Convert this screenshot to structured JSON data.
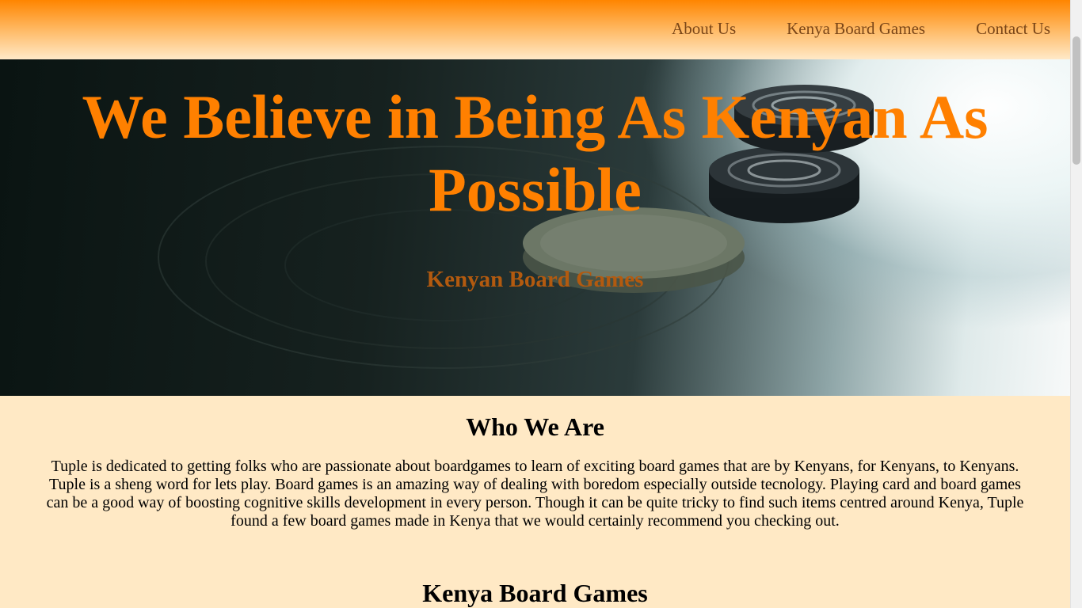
{
  "nav": {
    "links": [
      "About Us",
      "Kenya Board Games",
      "Contact Us"
    ]
  },
  "hero": {
    "title": "We Believe in Being As Kenyan As Possible",
    "subtitle": "Kenyan Board Games",
    "image_description": "board game pieces"
  },
  "about": {
    "heading": "Who We Are",
    "text": "Tuple is dedicated to getting folks who are passionate about boardgames to learn of exciting board games that are by Kenyans, for Kenyans, to Kenyans. Tuple is a sheng word for lets play. Board games is an amazing way of dealing with boredom especially outside tecnology. Playing card and board games can be a good way of boosting cognitive skills development in every person. Though it can be quite tricky to find such items centred around Kenya, Tuple found a few board games made in Kenya that we would certainly recommend you checking out."
  },
  "games": {
    "heading": "Kenya Board Games"
  },
  "colors": {
    "accent": "#ff8000",
    "nav_gradient_top": "#ff8500",
    "page_background": "#ffe9c5",
    "subtitle": "#b35a0f"
  }
}
